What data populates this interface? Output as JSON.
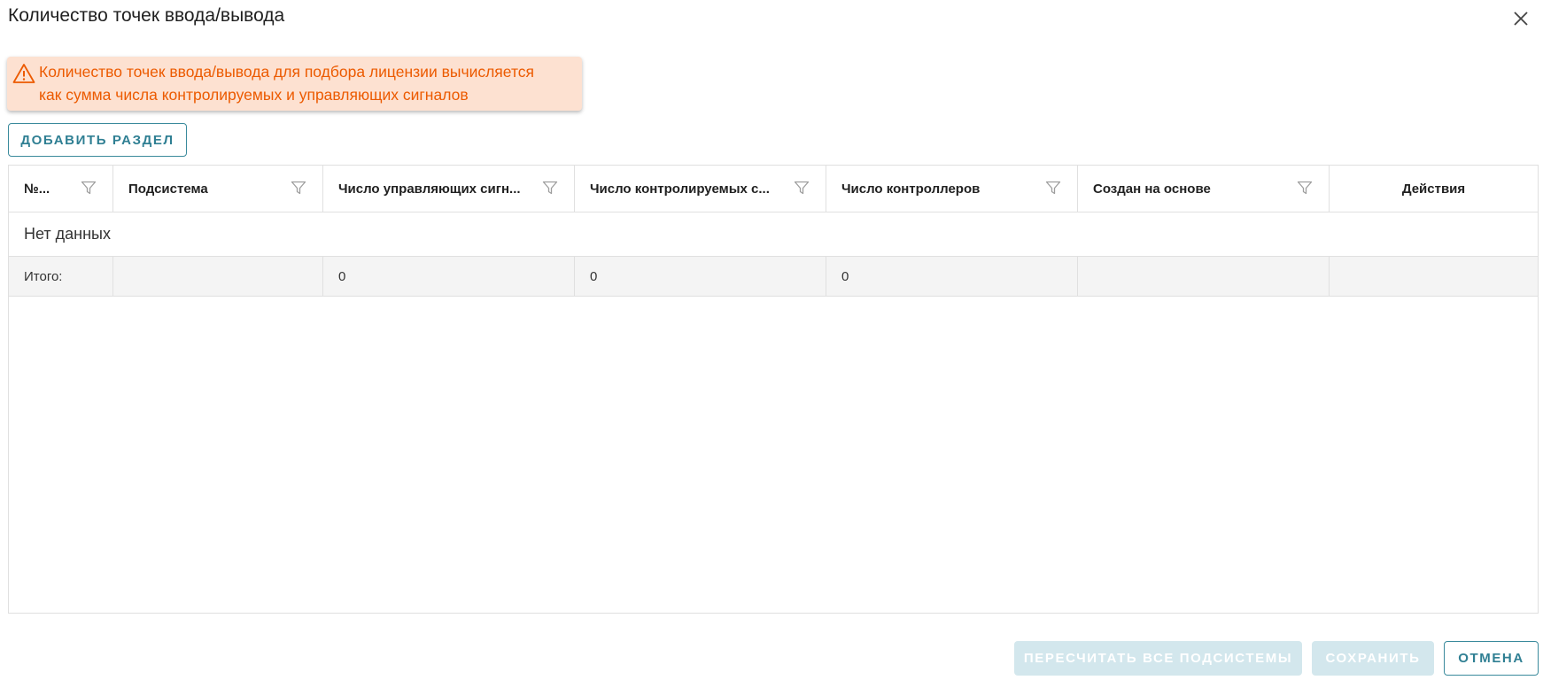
{
  "dialog": {
    "title": "Количество точек ввода/вывода",
    "close_icon": "close-icon"
  },
  "alert": {
    "icon": "warning-icon",
    "line1": "Количество точек ввода/вывода для подбора лицензии вычисляется",
    "line2": "как сумма числа контролируемых и управляющих сигналов",
    "color": "#ec5a00",
    "background": "#fde1d1"
  },
  "toolbar": {
    "add_section_label": "ДОБАВИТЬ РАЗДЕЛ"
  },
  "table": {
    "columns": [
      {
        "label": "№...",
        "filter": true
      },
      {
        "label": "Подсистема",
        "filter": true
      },
      {
        "label": "Число управляющих сигн...",
        "filter": true
      },
      {
        "label": "Число контролируемых с...",
        "filter": true
      },
      {
        "label": "Число контроллеров",
        "filter": true
      },
      {
        "label": "Создан на основе",
        "filter": true
      },
      {
        "label": "Действия",
        "filter": false
      }
    ],
    "empty_text": "Нет данных",
    "totals": [
      "Итого:",
      "",
      "0",
      "0",
      "0",
      "",
      ""
    ]
  },
  "footer": {
    "recalc_label": "ПЕРЕСЧИТАТЬ ВСЕ ПОДСИСТЕМЫ",
    "save_label": "СОХРАНИТЬ",
    "cancel_label": "ОТМЕНА"
  },
  "colors": {
    "accent": "#2f7f93",
    "disabled_button": "#d3e7ed"
  }
}
